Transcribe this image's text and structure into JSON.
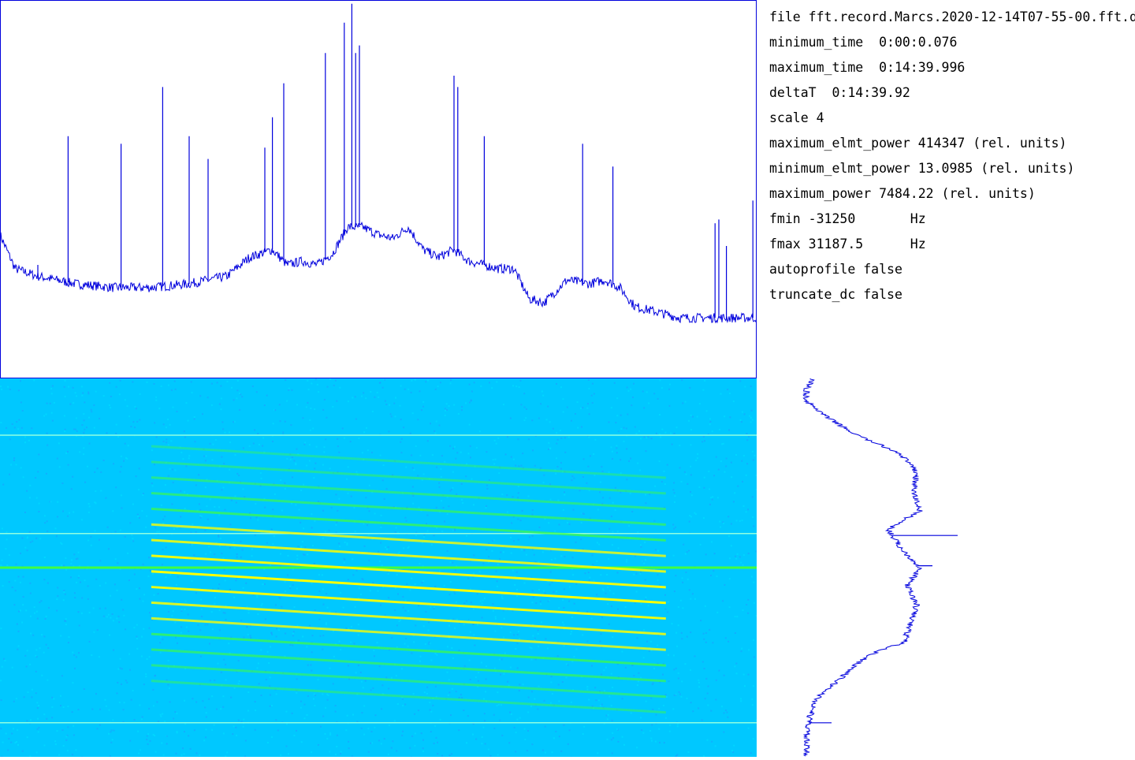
{
  "info": {
    "file": "file fft.record.Marcs.2020-12-14T07-55-00.fft.d",
    "minimum_time": "minimum_time  0:00:0.076",
    "maximum_time": "maximum_time  0:14:39.996",
    "deltaT": "deltaT  0:14:39.92",
    "scale": "scale 4",
    "maximum_elmt_power": "maximum_elmt_power 414347 (rel. units)",
    "minimum_elmt_power": "minimum_elmt_power 13.0985 (rel. units)",
    "maximum_power": "maximum_power 7484.22 (rel. units)",
    "fmin": "fmin -31250       Hz",
    "fmax": "fmax 31187.5      Hz",
    "autoprofile": "autoprofile false",
    "truncate_dc": "truncate_dc false"
  },
  "colors": {
    "line": "#0000dd",
    "waterfall_background": "#00c8ff",
    "waterfall_high": "#40ff40",
    "waterfall_peak": "#ffff00"
  },
  "chart_data": [
    {
      "type": "line",
      "name": "frequency-profile",
      "xlim": [
        -31250,
        31187.5
      ],
      "baseline": [
        [
          0,
          0.38
        ],
        [
          0.02,
          0.29
        ],
        [
          0.05,
          0.27
        ],
        [
          0.1,
          0.25
        ],
        [
          0.15,
          0.24
        ],
        [
          0.2,
          0.24
        ],
        [
          0.25,
          0.25
        ],
        [
          0.3,
          0.27
        ],
        [
          0.33,
          0.32
        ],
        [
          0.36,
          0.34
        ],
        [
          0.38,
          0.3
        ],
        [
          0.4,
          0.31
        ],
        [
          0.42,
          0.3
        ],
        [
          0.44,
          0.33
        ],
        [
          0.46,
          0.4
        ],
        [
          0.48,
          0.4
        ],
        [
          0.5,
          0.38
        ],
        [
          0.52,
          0.37
        ],
        [
          0.54,
          0.4
        ],
        [
          0.56,
          0.34
        ],
        [
          0.58,
          0.32
        ],
        [
          0.6,
          0.34
        ],
        [
          0.62,
          0.31
        ],
        [
          0.64,
          0.3
        ],
        [
          0.66,
          0.29
        ],
        [
          0.68,
          0.29
        ],
        [
          0.7,
          0.21
        ],
        [
          0.72,
          0.2
        ],
        [
          0.75,
          0.26
        ],
        [
          0.78,
          0.25
        ],
        [
          0.8,
          0.26
        ],
        [
          0.82,
          0.24
        ],
        [
          0.84,
          0.19
        ],
        [
          0.86,
          0.18
        ],
        [
          0.88,
          0.17
        ],
        [
          0.9,
          0.16
        ],
        [
          0.92,
          0.16
        ],
        [
          0.94,
          0.16
        ],
        [
          1.0,
          0.16
        ]
      ],
      "spikes": [
        [
          0.05,
          0.3
        ],
        [
          0.09,
          0.64
        ],
        [
          0.16,
          0.62
        ],
        [
          0.215,
          0.77
        ],
        [
          0.25,
          0.64
        ],
        [
          0.275,
          0.58
        ],
        [
          0.35,
          0.61
        ],
        [
          0.36,
          0.69
        ],
        [
          0.375,
          0.78
        ],
        [
          0.43,
          0.86
        ],
        [
          0.455,
          0.94
        ],
        [
          0.465,
          0.99
        ],
        [
          0.47,
          0.86
        ],
        [
          0.475,
          0.88
        ],
        [
          0.6,
          0.8
        ],
        [
          0.605,
          0.77
        ],
        [
          0.64,
          0.64
        ],
        [
          0.77,
          0.62
        ],
        [
          0.81,
          0.56
        ],
        [
          0.945,
          0.41
        ],
        [
          0.95,
          0.42
        ],
        [
          0.96,
          0.35
        ],
        [
          0.995,
          0.47
        ]
      ]
    },
    {
      "type": "line",
      "name": "time-profile",
      "baseline": [
        [
          0,
          0.04
        ],
        [
          0.03,
          0.02
        ],
        [
          0.06,
          0.02
        ],
        [
          0.1,
          0.08
        ],
        [
          0.15,
          0.18
        ],
        [
          0.2,
          0.32
        ],
        [
          0.25,
          0.37
        ],
        [
          0.3,
          0.36
        ],
        [
          0.35,
          0.38
        ],
        [
          0.4,
          0.28
        ],
        [
          0.45,
          0.32
        ],
        [
          0.5,
          0.38
        ],
        [
          0.55,
          0.34
        ],
        [
          0.6,
          0.37
        ],
        [
          0.65,
          0.35
        ],
        [
          0.7,
          0.33
        ],
        [
          0.72,
          0.25
        ],
        [
          0.75,
          0.19
        ],
        [
          0.8,
          0.12
        ],
        [
          0.85,
          0.05
        ],
        [
          0.9,
          0.03
        ],
        [
          0.95,
          0.02
        ],
        [
          1,
          0.02
        ]
      ],
      "spikes": [
        [
          0.415,
          0.5
        ],
        [
          0.495,
          0.42
        ],
        [
          0.91,
          0.1
        ]
      ]
    },
    {
      "type": "heatmap",
      "name": "waterfall-spectrogram",
      "hotspot": {
        "x_range": [
          0.2,
          0.88
        ],
        "y_range": [
          0.2,
          0.82
        ]
      },
      "line_rows": [
        0.15,
        0.41,
        0.5,
        0.91
      ]
    }
  ]
}
